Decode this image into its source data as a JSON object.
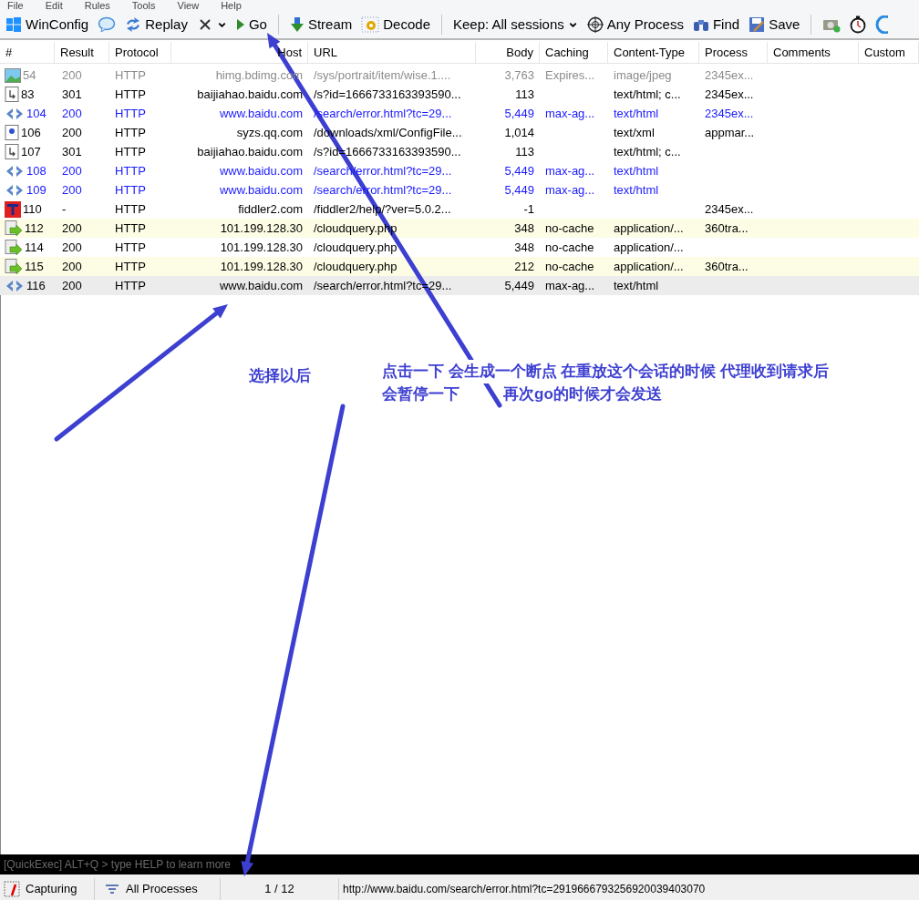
{
  "menu": [
    "File",
    "Edit",
    "Rules",
    "Tools",
    "View",
    "Help"
  ],
  "toolbar": [
    {
      "kind": "button",
      "label": "WinConfig",
      "caret": false
    },
    {
      "kind": "button",
      "caret": false
    },
    {
      "kind": "button",
      "label": "Replay",
      "caret": false
    },
    {
      "kind": "button",
      "caret": true
    },
    {
      "kind": "button",
      "label": "Go",
      "caret": false
    },
    {
      "kind": "separator"
    },
    {
      "kind": "button",
      "label": "Stream",
      "caret": false
    },
    {
      "kind": "button",
      "label": "Decode",
      "caret": false
    },
    {
      "kind": "separator"
    },
    {
      "kind": "button",
      "label": "Keep: All sessions",
      "caret": true
    },
    {
      "kind": "button",
      "label": "Any Process",
      "caret": false
    },
    {
      "kind": "button",
      "label": "Find",
      "caret": false
    },
    {
      "kind": "button",
      "label": "Save",
      "caret": false
    },
    {
      "kind": "separator"
    },
    {
      "kind": "button",
      "caret": false
    },
    {
      "kind": "button",
      "caret": false
    },
    {
      "kind": "button",
      "caret": false
    }
  ],
  "table": {
    "columns": [
      "#",
      "Result",
      "Protocol",
      "Host",
      "URL",
      "Body",
      "Caching",
      "Content-Type",
      "Process",
      "Comments",
      "Custom"
    ],
    "rows": [
      {
        "kind": "image",
        "color": "#8c8c8c",
        "highlighted": false,
        "selected": false,
        "cells": [
          "54",
          "200",
          "HTTP",
          "himg.bdimg.com",
          "/sys/portrait/item/wise.1....",
          "3,763",
          "Expires...",
          "image/jpeg",
          "2345ex..."
        ]
      },
      {
        "kind": "redirect",
        "color": "#000000",
        "highlighted": false,
        "selected": false,
        "cells": [
          "83",
          "301",
          "HTTP",
          "baijiahao.baidu.com",
          "/s?id=1666733163393590...",
          "113",
          "",
          "text/html; c...",
          "2345ex..."
        ]
      },
      {
        "kind": "html",
        "color": "#1a1aff",
        "highlighted": false,
        "selected": false,
        "cells": [
          "104",
          "200",
          "HTTP",
          "www.baidu.com",
          "/search/error.html?tc=29...",
          "5,449",
          "max-ag...",
          "text/html",
          "2345ex..."
        ]
      },
      {
        "kind": "xml",
        "color": "#000000",
        "highlighted": false,
        "selected": false,
        "cells": [
          "106",
          "200",
          "HTTP",
          "syzs.qq.com",
          "/downloads/xml/ConfigFile...",
          "1,014",
          "",
          "text/xml",
          "appmar..."
        ]
      },
      {
        "kind": "redirect",
        "color": "#000000",
        "highlighted": false,
        "selected": false,
        "cells": [
          "107",
          "301",
          "HTTP",
          "baijiahao.baidu.com",
          "/s?id=1666733163393590...",
          "113",
          "",
          "text/html; c...",
          ""
        ]
      },
      {
        "kind": "html",
        "color": "#1a1aff",
        "highlighted": false,
        "selected": false,
        "cells": [
          "108",
          "200",
          "HTTP",
          "www.baidu.com",
          "/search/error.html?tc=29...",
          "5,449",
          "max-ag...",
          "text/html",
          ""
        ]
      },
      {
        "kind": "html",
        "color": "#1a1aff",
        "highlighted": false,
        "selected": false,
        "cells": [
          "109",
          "200",
          "HTTP",
          "www.baidu.com",
          "/search/error.html?tc=29...",
          "5,449",
          "max-ag...",
          "text/html",
          ""
        ]
      },
      {
        "kind": "tunnel",
        "color": "#000000",
        "highlighted": false,
        "selected": false,
        "cells": [
          "110",
          "-",
          "HTTP",
          "fiddler2.com",
          "/fiddler2/help/?ver=5.0.2...",
          "-1",
          "",
          "",
          "2345ex..."
        ]
      },
      {
        "kind": "script",
        "color": "#000000",
        "highlighted": true,
        "selected": false,
        "cells": [
          "112",
          "200",
          "HTTP",
          "101.199.128.30",
          "/cloudquery.php",
          "348",
          "no-cache",
          "application/...",
          "360tra..."
        ]
      },
      {
        "kind": "script",
        "color": "#000000",
        "highlighted": false,
        "selected": false,
        "cells": [
          "114",
          "200",
          "HTTP",
          "101.199.128.30",
          "/cloudquery.php",
          "348",
          "no-cache",
          "application/...",
          ""
        ]
      },
      {
        "kind": "script",
        "color": "#000000",
        "highlighted": true,
        "selected": false,
        "cells": [
          "115",
          "200",
          "HTTP",
          "101.199.128.30",
          "/cloudquery.php",
          "212",
          "no-cache",
          "application/...",
          "360tra..."
        ]
      },
      {
        "kind": "html",
        "color": "#000000",
        "highlighted": false,
        "selected": true,
        "cells": [
          "116",
          "200",
          "HTTP",
          "www.baidu.com",
          "/search/error.html?tc=29...",
          "5,449",
          "max-ag...",
          "text/html",
          ""
        ]
      }
    ]
  },
  "annotations": [
    "选择以后",
    "点击一下 会生成一个断点 在重放这个会话的时候 代理收到请求后",
    "会暂停一下",
    "再次go的时候才会发送"
  ],
  "quickexec": {
    "placeholder": "[QuickExec] ALT+Q > type HELP to learn more"
  },
  "status_bar": {
    "capturing": "Capturing",
    "processes": "All Processes",
    "count": "1 / 12",
    "url": "http://www.baidu.com/search/error.html?tc=2919666793256920039403070"
  }
}
